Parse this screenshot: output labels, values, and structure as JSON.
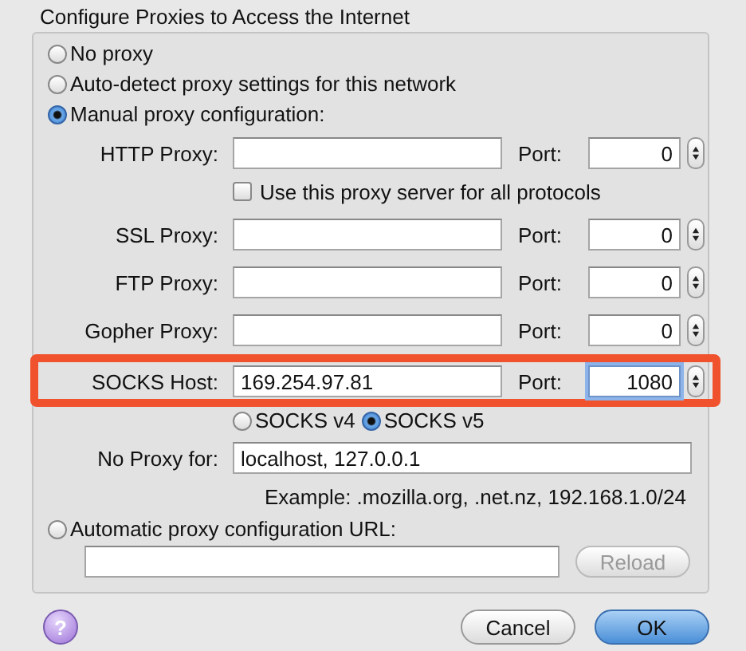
{
  "dialog": {
    "title": "Configure Proxies to Access the Internet"
  },
  "modes": [
    {
      "label": "No proxy",
      "selected": false
    },
    {
      "label": "Auto-detect proxy settings for this network",
      "selected": false
    },
    {
      "label": "Manual proxy configuration:",
      "selected": true
    }
  ],
  "proxies": [
    {
      "label": "HTTP Proxy:",
      "port_label": "Port:",
      "port": "0",
      "focused": false,
      "highlighted": false
    },
    {
      "label": "SSL Proxy:",
      "port_label": "Port:",
      "port": "0",
      "focused": false,
      "highlighted": false
    },
    {
      "label": "FTP Proxy:",
      "port_label": "Port:",
      "port": "0",
      "focused": false,
      "highlighted": false
    },
    {
      "label": "Gopher Proxy:",
      "port_label": "Port:",
      "port": "0",
      "focused": false,
      "highlighted": false
    },
    {
      "label": "SOCKS Host:",
      "value": "169.254.97.81",
      "port_label": "Port:",
      "port": "1080",
      "focused": true,
      "highlighted": true
    }
  ],
  "share_all": {
    "label": "Use this proxy server for all protocols",
    "checked": false
  },
  "socks_versions": [
    {
      "label": "SOCKS v4",
      "selected": false
    },
    {
      "label": "SOCKS v5",
      "selected": true
    }
  ],
  "no_proxy": {
    "label": "No Proxy for:",
    "value": "localhost, 127.0.0.1",
    "example": "Example: .mozilla.org, .net.nz, 192.168.1.0/24"
  },
  "auto_config": {
    "label": "Automatic proxy configuration URL:",
    "selected": false,
    "reload": {
      "label": "Reload",
      "disabled": true
    }
  },
  "help": "?",
  "buttons": [
    {
      "label": "Cancel",
      "default": false
    },
    {
      "label": "OK",
      "default": true
    }
  ]
}
